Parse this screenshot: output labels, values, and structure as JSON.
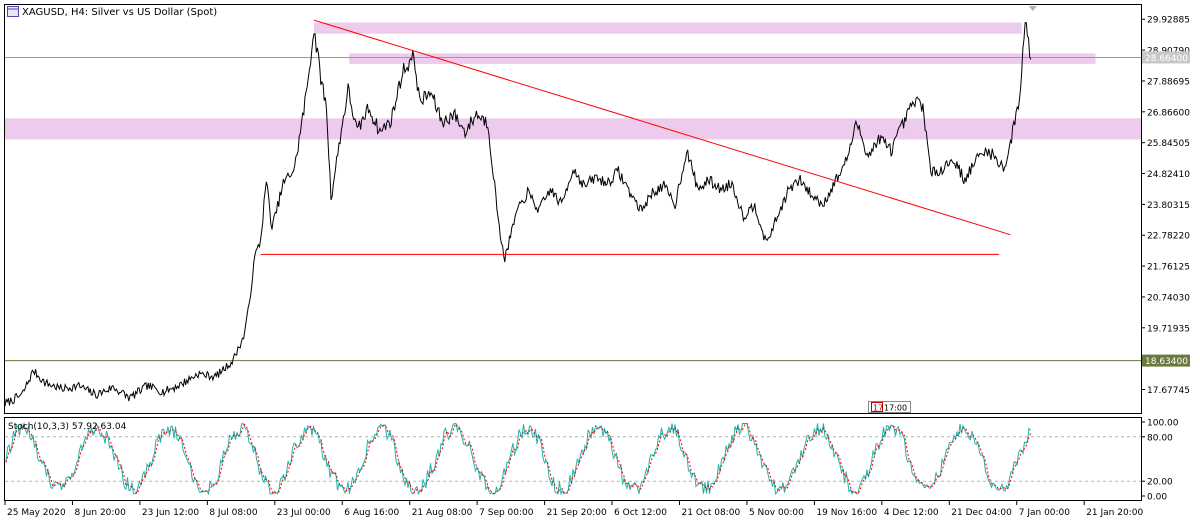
{
  "header": {
    "title": "XAGUSD, H4:  Silver vs US Dollar (Spot)"
  },
  "colors": {
    "price_line": "#000000",
    "trendline": "#ff0000",
    "support_line": "#ff0000",
    "zone_fill": "#ecc8ec",
    "level_line": "#6b7a3e",
    "stoch_main": "#20b2aa",
    "stoch_signal": "#ff0000",
    "grid_dash": "#b4b4b4"
  },
  "chart_data": {
    "type": "line",
    "symbol": "XAGUSD",
    "timeframe": "H4",
    "price_axis": {
      "ylim": [
        16.9,
        30.4
      ],
      "ticks": [
        "29.92885",
        "28.90790",
        "27.88695",
        "26.86600",
        "25.84505",
        "24.82410",
        "23.80315",
        "22.78220",
        "21.76125",
        "20.74030",
        "19.71935",
        "18.63400",
        "17.67745"
      ],
      "current_price_label": "28.66400",
      "current_price": 28.664,
      "highlight_level_label": "18.63400",
      "highlight_level": 18.634
    },
    "time_axis": {
      "labels": [
        "25 May 2020",
        "8 Jun 20:00",
        "23 Jun 12:00",
        "8 Jul 08:00",
        "23 Jul 00:00",
        "6 Aug 16:00",
        "21 Aug 08:00",
        "7 Sep 00:00",
        "21 Sep 20:00",
        "6 Oct 12:00",
        "21 Oct 08:00",
        "5 Nov 00:00",
        "19 Nov 16:00",
        "4 Dec 12:00",
        "21 Dec 04:00",
        "7 Jan 00:00",
        "21 Jan 20:00"
      ],
      "xlim": [
        0,
        100
      ]
    },
    "series": [
      {
        "values": [
          [
            0,
            17.2
          ],
          [
            1.5,
            17.5
          ],
          [
            2.5,
            18.3
          ],
          [
            3.5,
            17.9
          ],
          [
            5,
            17.7
          ],
          [
            6.5,
            17.8
          ],
          [
            8,
            17.5
          ],
          [
            9.5,
            17.75
          ],
          [
            11,
            17.4
          ],
          [
            12.5,
            17.8
          ],
          [
            14,
            17.6
          ],
          [
            15.5,
            17.85
          ],
          [
            17,
            18.2
          ],
          [
            18.5,
            18.1
          ],
          [
            20,
            18.6
          ],
          [
            21,
            19.4
          ],
          [
            21.5,
            20.5
          ],
          [
            22,
            22.1
          ],
          [
            22.5,
            22.6
          ],
          [
            23,
            24.6
          ],
          [
            23.5,
            23.0
          ],
          [
            24.5,
            24.5
          ],
          [
            25.5,
            25.0
          ],
          [
            26.5,
            27.4
          ],
          [
            27.2,
            29.6
          ],
          [
            27.8,
            28.0
          ],
          [
            28.3,
            27.0
          ],
          [
            28.7,
            24.0
          ],
          [
            29.5,
            26.0
          ],
          [
            30.2,
            27.6
          ],
          [
            31,
            26.2
          ],
          [
            32,
            27.0
          ],
          [
            33,
            26.2
          ],
          [
            34,
            26.6
          ],
          [
            35,
            28.2
          ],
          [
            36,
            28.7
          ],
          [
            36.5,
            27.2
          ],
          [
            37.5,
            27.5
          ],
          [
            38.5,
            26.5
          ],
          [
            39.5,
            26.8
          ],
          [
            40.5,
            26.2
          ],
          [
            41.5,
            26.8
          ],
          [
            42.5,
            26.5
          ],
          [
            43,
            24.8
          ],
          [
            43.5,
            23.0
          ],
          [
            44,
            22.0
          ],
          [
            45,
            23.5
          ],
          [
            46,
            24.2
          ],
          [
            47,
            23.6
          ],
          [
            48,
            24.3
          ],
          [
            49,
            23.8
          ],
          [
            50,
            25.0
          ],
          [
            51,
            24.4
          ],
          [
            52,
            24.7
          ],
          [
            53,
            24.5
          ],
          [
            54,
            24.9
          ],
          [
            55,
            24.2
          ],
          [
            56,
            23.6
          ],
          [
            57,
            24.2
          ],
          [
            58,
            24.4
          ],
          [
            59,
            23.8
          ],
          [
            60,
            25.6
          ],
          [
            61,
            24.3
          ],
          [
            62,
            24.6
          ],
          [
            63,
            24.3
          ],
          [
            64,
            24.5
          ],
          [
            65,
            23.4
          ],
          [
            66,
            23.8
          ],
          [
            67,
            22.5
          ],
          [
            68,
            23.4
          ],
          [
            69,
            24.3
          ],
          [
            70,
            24.6
          ],
          [
            71,
            24.1
          ],
          [
            72,
            23.8
          ],
          [
            73,
            24.5
          ],
          [
            74,
            25.2
          ],
          [
            75,
            26.5
          ],
          [
            76,
            25.4
          ],
          [
            77,
            26.0
          ],
          [
            78,
            25.6
          ],
          [
            79,
            26.4
          ],
          [
            80,
            27.2
          ],
          [
            80.8,
            27.1
          ],
          [
            81.5,
            24.8
          ],
          [
            82.5,
            25.0
          ],
          [
            83.5,
            25.3
          ],
          [
            84.5,
            24.6
          ],
          [
            85.5,
            25.3
          ],
          [
            86.5,
            25.6
          ],
          [
            87.5,
            25.2
          ],
          [
            88,
            25.0
          ],
          [
            88.6,
            26.0
          ],
          [
            89.3,
            27.3
          ],
          [
            89.8,
            29.9
          ],
          [
            90.3,
            28.6
          ]
        ],
        "y_unit": "USD"
      }
    ],
    "annotations": {
      "trendline": [
        [
          27.2,
          29.9
        ],
        [
          88.5,
          22.8
        ]
      ],
      "support_line": {
        "x": [
          22.5,
          87.5
        ],
        "y": 22.15
      },
      "resistance_zones": [
        {
          "x": [
            27.2,
            89.5
          ],
          "y": [
            29.45,
            29.82
          ]
        },
        {
          "x": [
            30.3,
            96.0
          ],
          "y": [
            28.45,
            28.8
          ]
        },
        {
          "x": [
            0,
            100
          ],
          "y": [
            25.95,
            26.65
          ]
        }
      ]
    },
    "indicator": {
      "label": "Stoch(10,3,3) 57.92 63.04",
      "ylim": [
        0,
        100
      ],
      "ticks": [
        "100.00",
        "80.00",
        "20.00",
        "0.00"
      ],
      "levels": [
        80,
        20
      ]
    },
    "period_marker": {
      "badge": "17",
      "time": "17:00"
    }
  }
}
